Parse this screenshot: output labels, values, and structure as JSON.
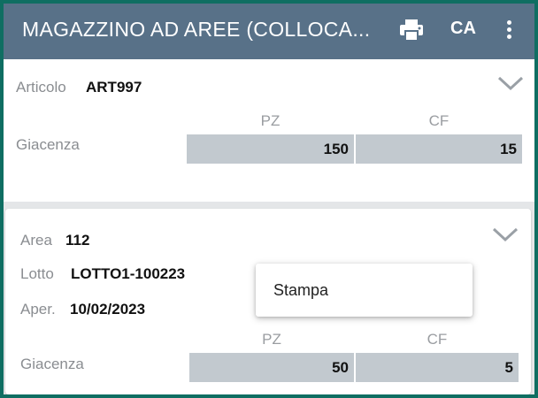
{
  "appbar": {
    "title": "MAGAZZINO AD AREE (COLLOCA...",
    "print_icon": "printer-icon",
    "ca_label": "CA",
    "more_icon": "more-vert-icon",
    "bg_color": "#587188"
  },
  "article_card": {
    "article_label": "Articolo",
    "article_value": "ART997",
    "col_pz": "PZ",
    "col_cf": "CF",
    "stock_label": "Giacenza",
    "stock_pz": "150",
    "stock_cf": "15",
    "expand_icon": "chevron-down-icon"
  },
  "area_card": {
    "area_label": "Area",
    "area_value": "112",
    "lot_label": "Lotto",
    "lot_value": "LOTTO1-100223",
    "open_label": "Aper.",
    "open_value": "10/02/2023",
    "col_pz": "PZ",
    "col_cf": "CF",
    "stock_label": "Giacenza",
    "stock_pz": "50",
    "stock_cf": "5",
    "expand_icon": "chevron-down-icon"
  },
  "popup_menu": {
    "items": [
      {
        "label": "Stampa"
      }
    ]
  }
}
